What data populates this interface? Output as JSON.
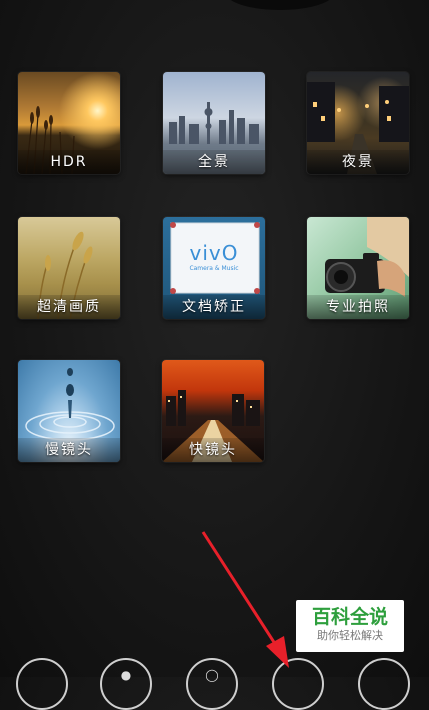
{
  "modes": [
    {
      "id": "hdr",
      "label": "HDR"
    },
    {
      "id": "panorama",
      "label": "全景"
    },
    {
      "id": "night",
      "label": "夜景"
    },
    {
      "id": "ultra-hd",
      "label": "超清画质"
    },
    {
      "id": "document",
      "label": "文档矫正"
    },
    {
      "id": "professional",
      "label": "专业拍照"
    },
    {
      "id": "slow-motion",
      "label": "慢镜头"
    },
    {
      "id": "timelapse",
      "label": "快镜头"
    }
  ],
  "document_card": {
    "brand": "vivO",
    "tagline": "Camera & Music"
  },
  "watermark": {
    "title": "百科全说",
    "subtitle": "助你轻松解决"
  },
  "colors": {
    "background": "#161616",
    "arrow": "#e8202a",
    "watermark_green": "#2e9f3d"
  }
}
